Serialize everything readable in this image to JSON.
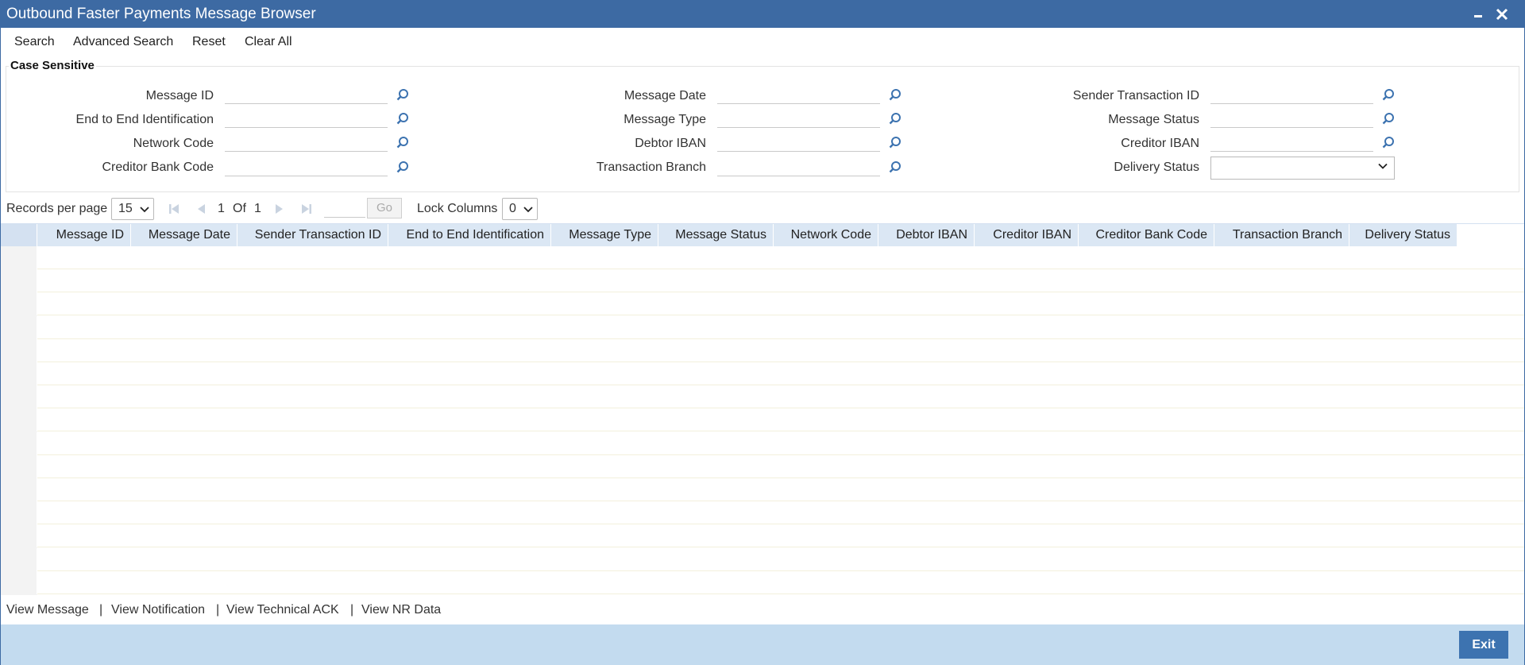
{
  "window": {
    "title": "Outbound Faster Payments Message Browser",
    "minimize_icon": "minimize-icon",
    "close_icon": "close-icon",
    "accent_color": "#3d6aa3"
  },
  "toolbar": {
    "search": "Search",
    "advanced_search": "Advanced Search",
    "reset": "Reset",
    "clear_all": "Clear All"
  },
  "criteria": {
    "legend": "Case Sensitive",
    "fields": {
      "message_id": {
        "label": "Message ID",
        "value": ""
      },
      "end_to_end": {
        "label": "End to End Identification",
        "value": ""
      },
      "network_code": {
        "label": "Network Code",
        "value": ""
      },
      "creditor_bank_code": {
        "label": "Creditor Bank Code",
        "value": ""
      },
      "message_date": {
        "label": "Message Date",
        "value": ""
      },
      "message_type": {
        "label": "Message Type",
        "value": ""
      },
      "debtor_iban": {
        "label": "Debtor IBAN",
        "value": ""
      },
      "transaction_branch": {
        "label": "Transaction Branch",
        "value": ""
      },
      "sender_txn_id": {
        "label": "Sender Transaction ID",
        "value": ""
      },
      "message_status": {
        "label": "Message Status",
        "value": ""
      },
      "creditor_iban": {
        "label": "Creditor IBAN",
        "value": ""
      },
      "delivery_status": {
        "label": "Delivery Status",
        "value": ""
      }
    }
  },
  "pager": {
    "records_per_page_label": "Records per page",
    "records_per_page": "15",
    "current_page": "1",
    "of_label": "Of",
    "total_pages": "1",
    "go_label": "Go",
    "lock_columns_label": "Lock Columns",
    "lock_columns": "0"
  },
  "grid": {
    "columns": [
      "Message ID",
      "Message Date",
      "Sender Transaction ID",
      "End to End Identification",
      "Message Type",
      "Message Status",
      "Network Code",
      "Debtor IBAN",
      "Creditor IBAN",
      "Creditor Bank Code",
      "Transaction Branch",
      "Delivery Status"
    ],
    "rows": []
  },
  "footer": {
    "view_message": "View Message",
    "view_notification": "View Notification",
    "view_technical_ack": "View Technical ACK",
    "view_nr_data": "View NR Data",
    "separator": "|",
    "exit": "Exit"
  }
}
